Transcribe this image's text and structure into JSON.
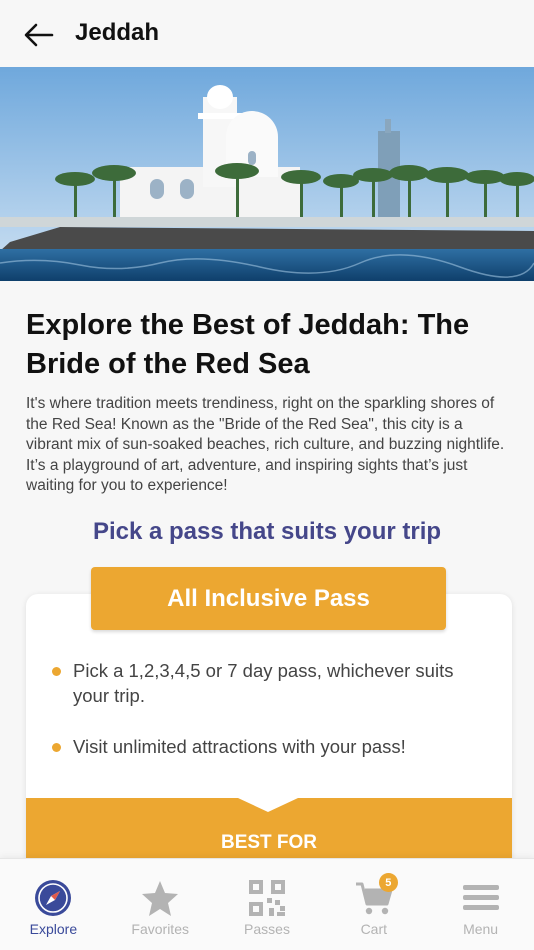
{
  "header": {
    "title": "Jeddah",
    "back_icon": "arrow-left-icon"
  },
  "hero": {
    "image": "Jeddah waterfront mosque with palm trees by the Red Sea"
  },
  "intro": {
    "headline": "Explore the Best of Jeddah: The Bride of the Red Sea",
    "body": "It's where tradition meets trendiness, right on the sparkling shores of the Red Sea! Known as the \"Bride of the Red Sea\", this city is a vibrant mix of sun-soaked beaches, rich culture, and buzzing nightlife. It’s a playground of art, adventure, and inspiring sights that’s just waiting for you to experience!"
  },
  "passes": {
    "subtitle": "Pick a pass that suits your trip",
    "selected_pass": "All Inclusive Pass",
    "features": [
      "Pick a 1,2,3,4,5 or 7 day pass, whichever suits your trip.",
      "Visit unlimited attractions with your pass!"
    ],
    "best_for_label": "BEST FOR"
  },
  "nav": {
    "items": [
      {
        "label": "Explore",
        "icon": "compass-icon",
        "active": true
      },
      {
        "label": "Favorites",
        "icon": "star-icon",
        "active": false
      },
      {
        "label": "Passes",
        "icon": "qr-code-icon",
        "active": false
      },
      {
        "label": "Cart",
        "icon": "cart-icon",
        "active": false,
        "badge": "5"
      },
      {
        "label": "Menu",
        "icon": "hamburger-menu-icon",
        "active": false
      }
    ]
  },
  "colors": {
    "accent": "#eca731",
    "primary": "#45478a",
    "nav_active": "#3a4a9a",
    "nav_inactive": "#b3b3b3"
  }
}
